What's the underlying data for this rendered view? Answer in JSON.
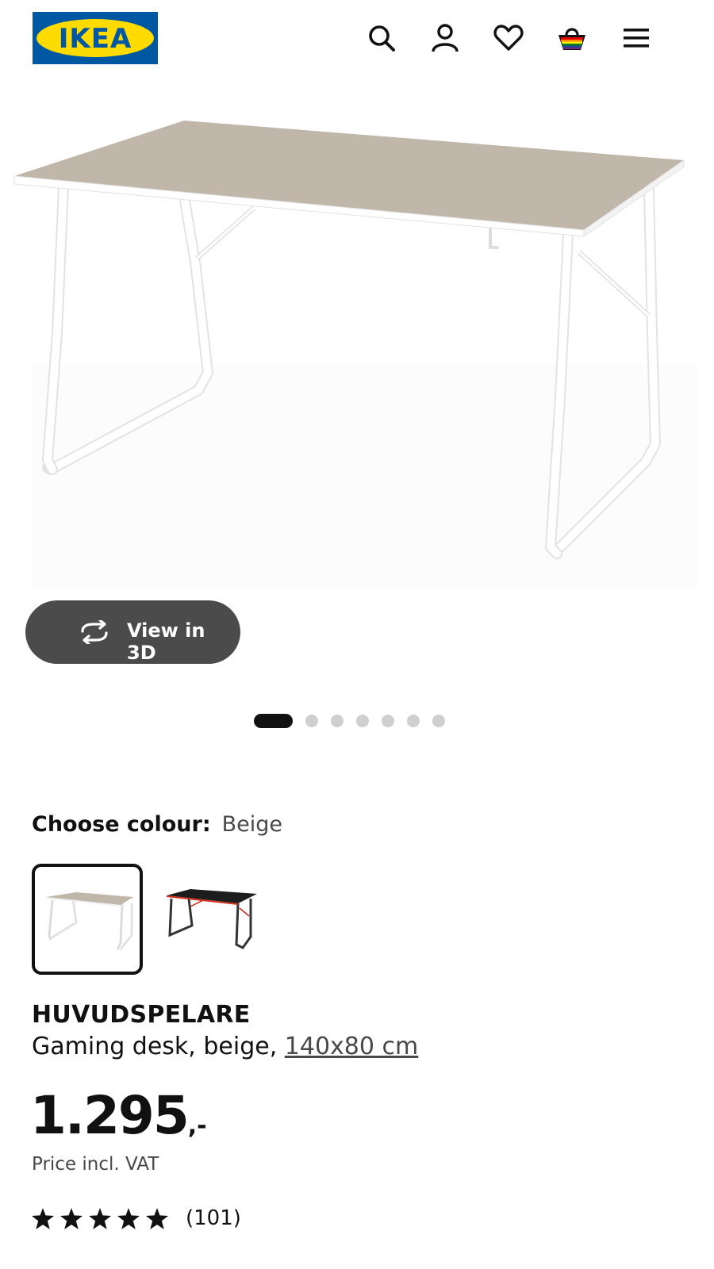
{
  "header": {
    "logo_text": "IKEA",
    "icons": [
      "search-icon",
      "user-icon",
      "heart-icon",
      "basket-icon",
      "menu-icon"
    ],
    "colors": {
      "logo_blue": "#0058A3",
      "logo_yellow": "#FFDB00"
    }
  },
  "gallery": {
    "view3d_label": "View in 3D",
    "slide_count": 7,
    "active_slide": 1
  },
  "colour": {
    "label": "Choose colour:",
    "selected": "Beige",
    "options": [
      "beige",
      "black-red"
    ]
  },
  "product": {
    "name": "HUVUDSPELARE",
    "description": "Gaming desk, beige, ",
    "size_link": "140x80 cm",
    "price_main": "1.295",
    "price_suffix": ",-",
    "vat_note": "Price incl. VAT",
    "rating": {
      "stars": 5,
      "count": "(101)"
    }
  }
}
